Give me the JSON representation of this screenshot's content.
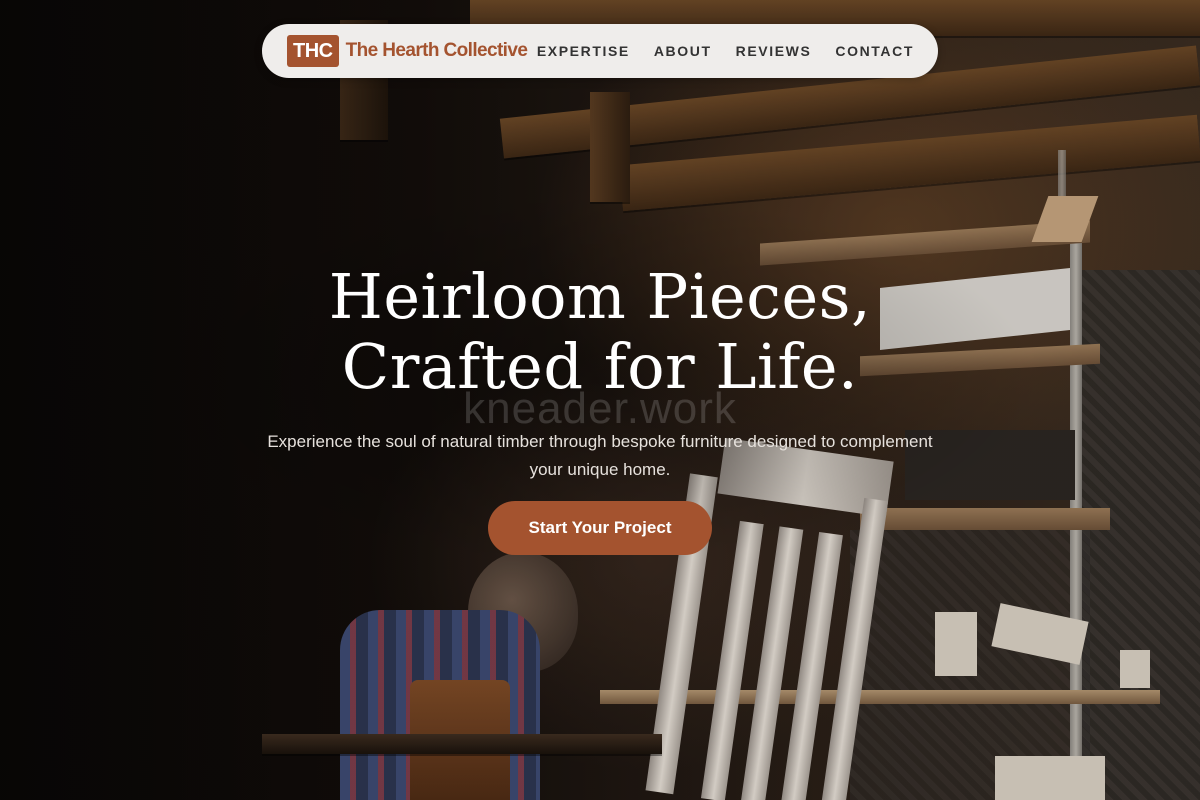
{
  "brand": {
    "logo_abbr": "THC",
    "name": "The Hearth Collective",
    "accent_color": "#a4532f"
  },
  "nav": {
    "links": [
      {
        "label": "EXPERTISE"
      },
      {
        "label": "ABOUT"
      },
      {
        "label": "REVIEWS"
      },
      {
        "label": "CONTACT"
      }
    ]
  },
  "hero": {
    "headline_line1": "Heirloom Pieces,",
    "headline_line2": "Crafted for Life.",
    "watermark": "kneader.work",
    "subtitle": "Experience the soul of natural timber through bespoke furniture designed to complement your unique home.",
    "cta_label": "Start Your Project",
    "background_image": "woodworking-workshop-photo"
  }
}
